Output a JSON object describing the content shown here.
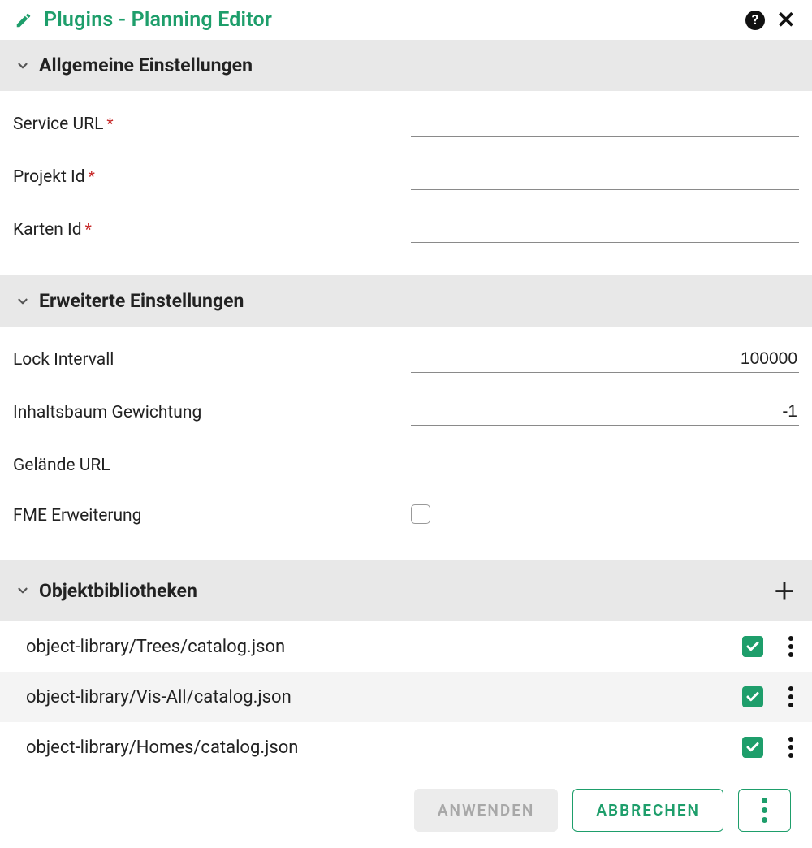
{
  "header": {
    "title": "Plugins - Planning Editor"
  },
  "sections": {
    "general": {
      "title": "Allgemeine Einstellungen",
      "fields": {
        "service_url": {
          "label": "Service URL",
          "required": true,
          "value": ""
        },
        "project_id": {
          "label": "Projekt Id",
          "required": true,
          "value": ""
        },
        "map_id": {
          "label": "Karten Id",
          "required": true,
          "value": ""
        }
      }
    },
    "advanced": {
      "title": "Erweiterte Einstellungen",
      "fields": {
        "lock_interval": {
          "label": "Lock Intervall",
          "value": "100000"
        },
        "tree_weight": {
          "label": "Inhaltsbaum Gewichtung",
          "value": "-1"
        },
        "terrain_url": {
          "label": "Gelände URL",
          "value": ""
        },
        "fme": {
          "label": "FME Erweiterung",
          "checked": false
        }
      }
    },
    "libraries": {
      "title": "Objektbibliotheken",
      "items": [
        {
          "path": "object-library/Trees/catalog.json",
          "enabled": true
        },
        {
          "path": "object-library/Vis-All/catalog.json",
          "enabled": true
        },
        {
          "path": "object-library/Homes/catalog.json",
          "enabled": true
        }
      ]
    }
  },
  "footer": {
    "apply": "ANWENDEN",
    "cancel": "ABBRECHEN"
  },
  "required_marker": "*"
}
